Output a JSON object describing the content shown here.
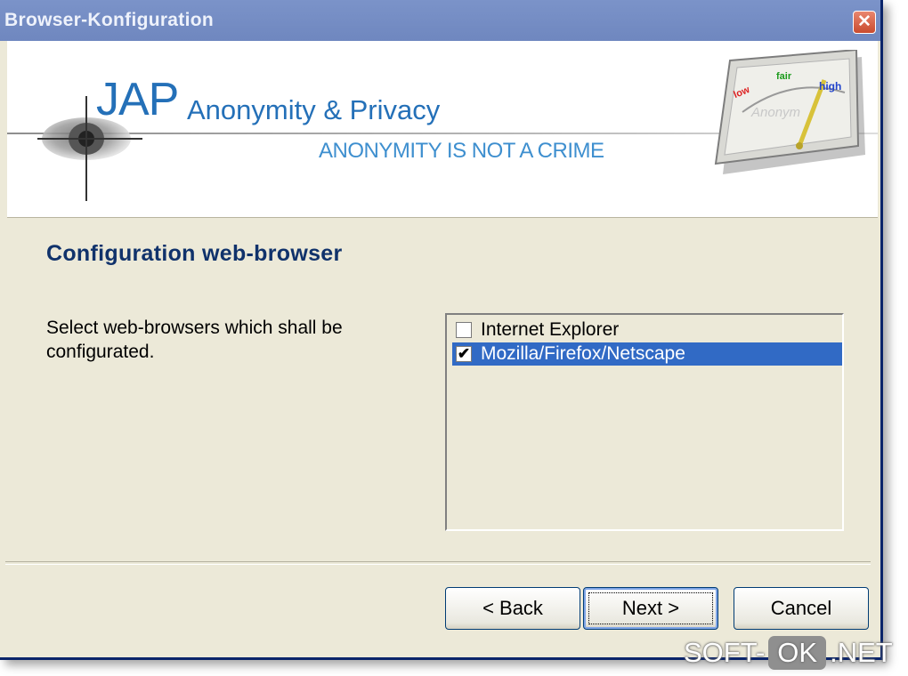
{
  "window": {
    "title": "Browser-Konfiguration",
    "close_glyph": "✕"
  },
  "banner": {
    "brand": "JAP",
    "tagline": "Anonymity & Privacy",
    "motto": "ANONYMITY IS NOT A CRIME",
    "gauge": {
      "low": "low",
      "fair": "fair",
      "high": "high",
      "caption": "Anonym"
    },
    "icons": [
      "eye-logo-icon",
      "anonymity-gauge-icon"
    ]
  },
  "page": {
    "heading": "Configuration web-browser",
    "instruction": "Select web-browsers which shall be configurated."
  },
  "browsers": [
    {
      "label": "Internet Explorer",
      "checked": false,
      "selected": false
    },
    {
      "label": "Mozilla/Firefox/Netscape",
      "checked": true,
      "selected": true
    }
  ],
  "buttons": {
    "back": "< Back",
    "next": "Next >",
    "cancel": "Cancel"
  },
  "watermark": {
    "left": "SOFT-",
    "mid": "OK",
    "right": ".NET"
  },
  "colors": {
    "selection": "#316ac5",
    "heading": "#10326b",
    "brand": "#2470b8",
    "titlebar": "#7b93c9"
  }
}
